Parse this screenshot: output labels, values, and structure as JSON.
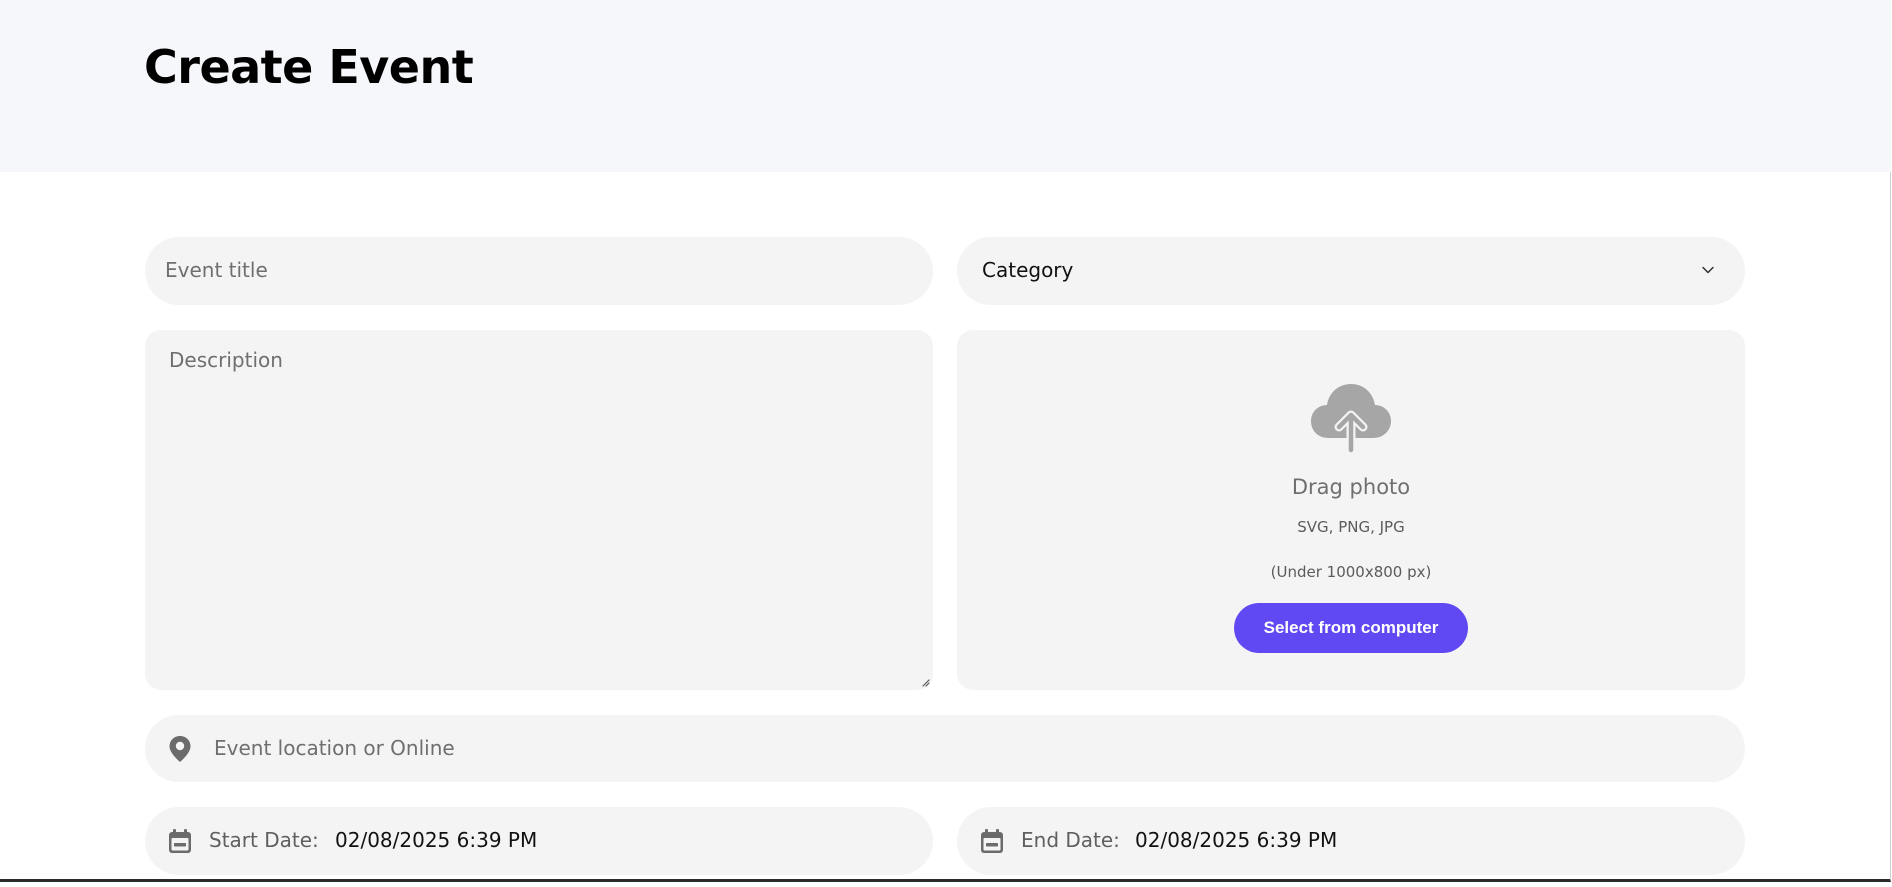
{
  "page": {
    "title": "Create Event"
  },
  "form": {
    "event_title": {
      "placeholder": "Event title",
      "value": ""
    },
    "category": {
      "selected": "Category",
      "icon": "chevron-down-icon"
    },
    "description": {
      "placeholder": "Description",
      "value": ""
    },
    "upload": {
      "icon": "cloud-upload-icon",
      "title": "Drag photo",
      "formats": "SVG, PNG, JPG",
      "size_hint": "(Under 1000x800 px)",
      "button_label": "Select from computer"
    },
    "location": {
      "icon": "map-pin-icon",
      "placeholder": "Event location or Online",
      "value": ""
    },
    "start_date": {
      "icon": "calendar-icon",
      "label": "Start Date:",
      "value": "02/08/2025 6:39 PM"
    },
    "end_date": {
      "icon": "calendar-icon",
      "label": "End Date:",
      "value": "02/08/2025 6:39 PM"
    }
  },
  "colors": {
    "header_background": "#f6f7fb",
    "field_background": "#f4f4f4",
    "accent": "#6049f2",
    "placeholder_text": "#6f6f6f",
    "icon_gray": "#a6a6a6"
  }
}
